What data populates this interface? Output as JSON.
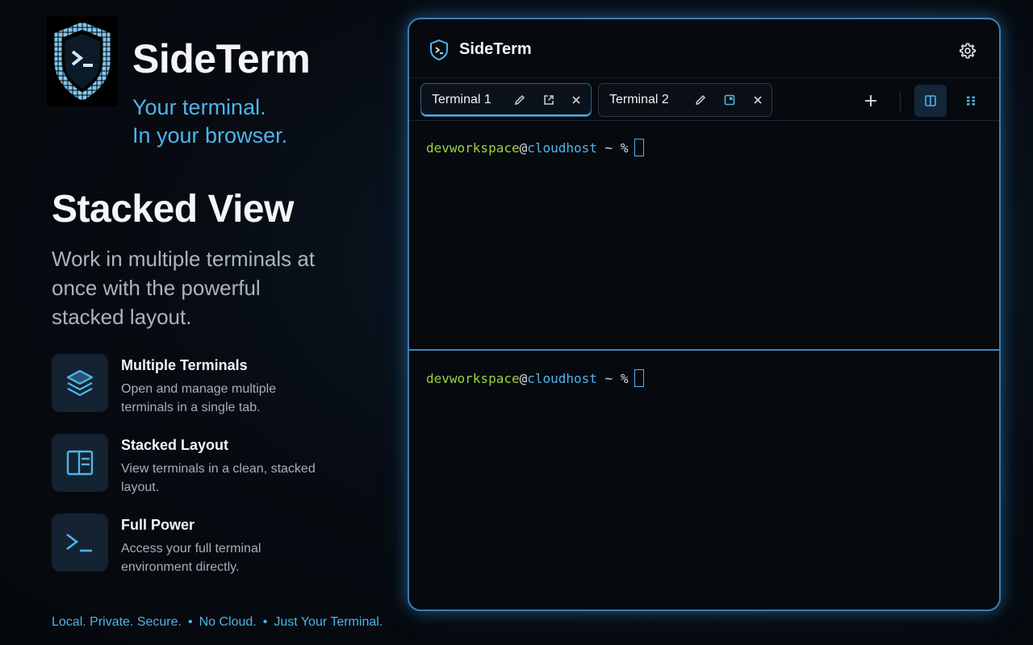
{
  "brand": {
    "name": "SideTerm",
    "tagline_line1": "Your terminal.",
    "tagline_line2": "In your browser."
  },
  "hero": {
    "title": "Stacked View",
    "description": "Work in multiple terminals at once with the powerful stacked layout."
  },
  "features": [
    {
      "title": "Multiple Terminals",
      "description": "Open and manage multiple terminals in a single tab.",
      "icon": "layers-icon"
    },
    {
      "title": "Stacked Layout",
      "description": "View terminals in a clean, stacked layout.",
      "icon": "layout-panels-icon"
    },
    {
      "title": "Full Power",
      "description": "Access your full terminal environment directly.",
      "icon": "terminal-prompt-icon"
    }
  ],
  "footer": {
    "items": [
      "Local. Private. Secure.",
      "No Cloud.",
      "Just Your Terminal."
    ],
    "separator": "•"
  },
  "window": {
    "title": "SideTerm",
    "tabs": [
      {
        "label": "Terminal 1",
        "active": true
      },
      {
        "label": "Terminal 2",
        "active": false
      }
    ],
    "panes": [
      {
        "user": "devworkspace",
        "at": "@",
        "host": "cloudhost",
        "rest": " ~ %"
      },
      {
        "user": "devworkspace",
        "at": "@",
        "host": "cloudhost",
        "rest": " ~ %"
      }
    ]
  },
  "colors": {
    "accent": "#4fb4ea",
    "prompt_user": "#9bd33d",
    "background": "#070b11"
  }
}
